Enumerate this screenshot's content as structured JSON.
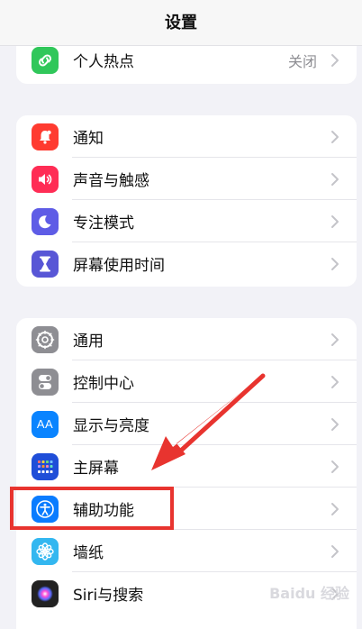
{
  "nav": {
    "title": "设置"
  },
  "colors": {
    "hotspot": "#30c75a",
    "notifications": "#ff3b30",
    "sounds": "#ff2d55",
    "focus": "#5e5ce6",
    "screen_time": "#5856d6",
    "general": "#8e8e93",
    "control_center": "#8e8e93",
    "display": "#0a84ff",
    "home_screen": "#1f4ed8",
    "accessibility": "#0a7cff",
    "wallpaper": "#33b7f0",
    "siri": "#222222",
    "highlight": "#e8342f"
  },
  "groups": [
    {
      "items": [
        {
          "label": "个人热点",
          "value": "关闭",
          "icon": "link-icon"
        }
      ]
    },
    {
      "items": [
        {
          "label": "通知",
          "icon": "bell-icon"
        },
        {
          "label": "声音与触感",
          "icon": "speaker-icon"
        },
        {
          "label": "专注模式",
          "icon": "moon-icon"
        },
        {
          "label": "屏幕使用时间",
          "icon": "hourglass-icon"
        }
      ]
    },
    {
      "items": [
        {
          "label": "通用",
          "icon": "gear-icon"
        },
        {
          "label": "控制中心",
          "icon": "toggles-icon"
        },
        {
          "label": "显示与亮度",
          "icon": "text-size-icon",
          "icon_text": "AA"
        },
        {
          "label": "主屏幕",
          "icon": "grid-icon"
        },
        {
          "label": "辅助功能",
          "icon": "accessibility-icon"
        },
        {
          "label": "墙纸",
          "icon": "flower-icon"
        },
        {
          "label": "Siri与搜索",
          "icon": "siri-icon"
        }
      ]
    }
  ],
  "watermark": "Baidu 经验"
}
